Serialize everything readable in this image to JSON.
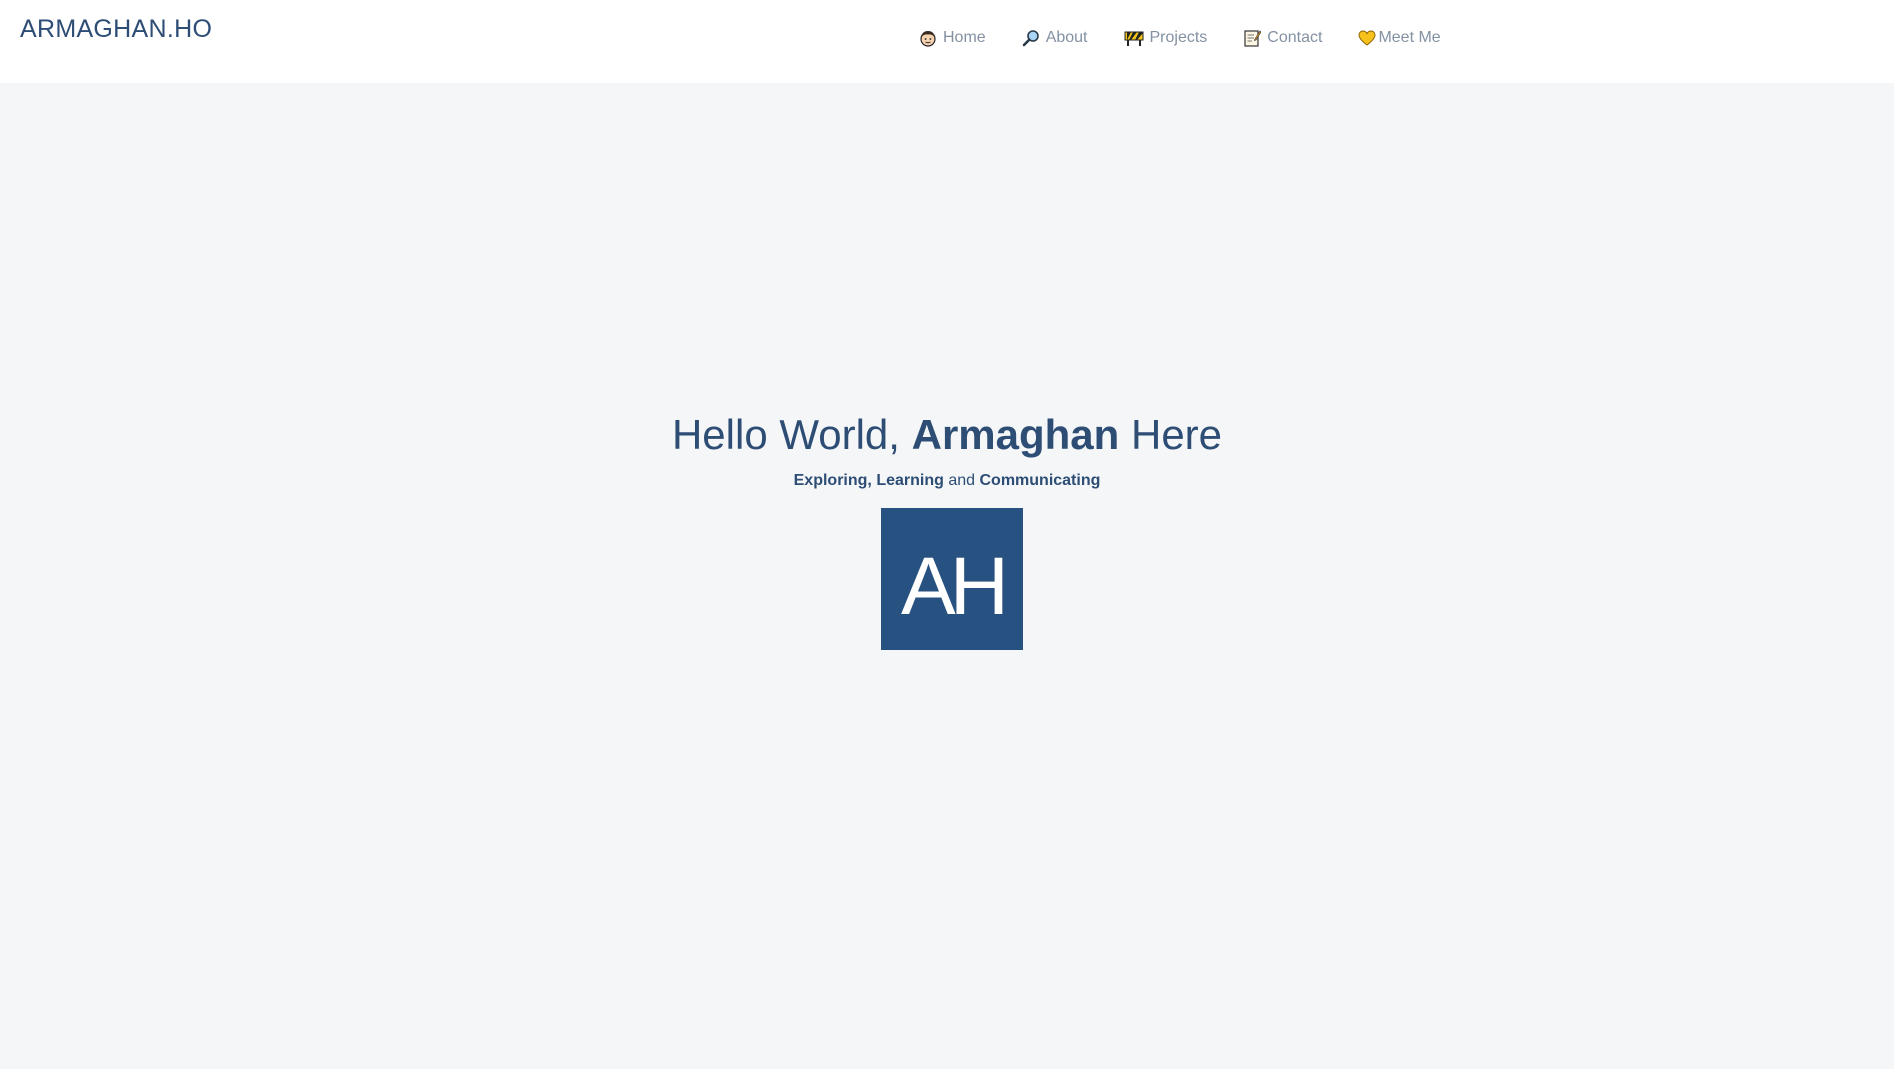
{
  "brand": "ARMAGHAN.HO",
  "nav": {
    "items": [
      {
        "label": "Home",
        "icon": "person-face-icon"
      },
      {
        "label": "About",
        "icon": "magnifying-glass-icon"
      },
      {
        "label": "Projects",
        "icon": "construction-barrier-icon"
      },
      {
        "label": "Contact",
        "icon": "memo-icon"
      },
      {
        "label": "Meet Me",
        "icon": "yellow-heart-icon"
      }
    ]
  },
  "hero": {
    "greeting_prefix": "Hello World, ",
    "greeting_name": "Armaghan",
    "greeting_suffix": " Here",
    "tag_exploring": "Exploring,",
    "tag_learning": "Learning",
    "tag_and": "and",
    "tag_communicating": "Communicating",
    "logo_text": "AH"
  },
  "colors": {
    "primary": "#2d4d75",
    "logo_bg": "#275180",
    "nav_text": "#8391a3",
    "page_bg": "#f4f6f8"
  }
}
